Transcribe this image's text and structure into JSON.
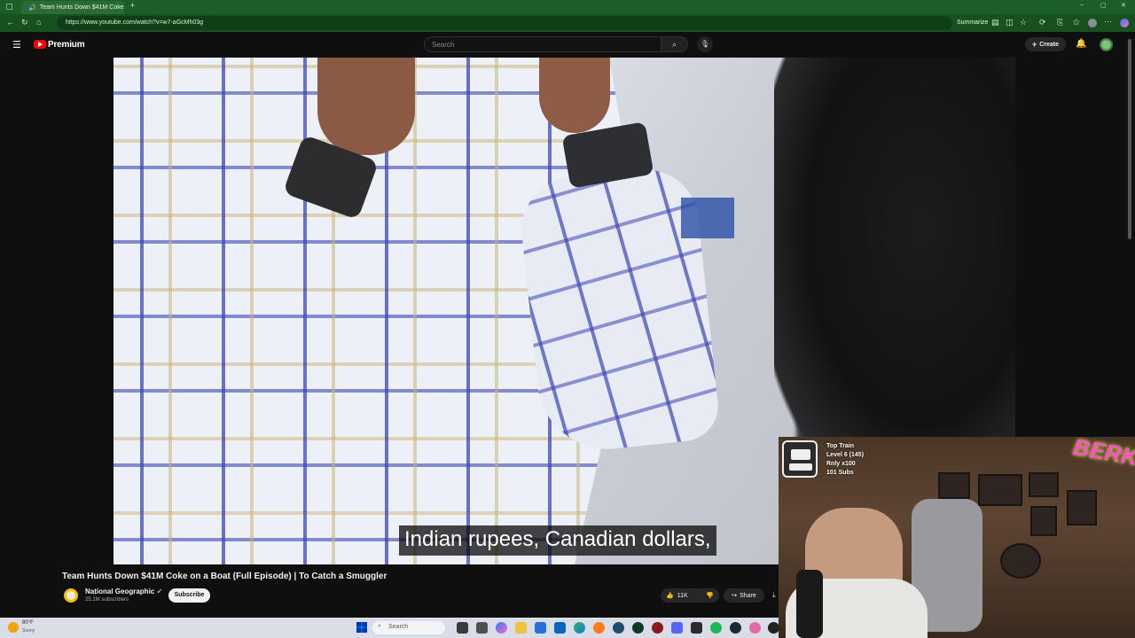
{
  "browser": {
    "tab_title": "Team Hunts Down $41M Coke",
    "url": "https://www.youtube.com/watch?v=w7-aGcMh03g",
    "summarize_label": "Summarize"
  },
  "youtube": {
    "logo_text": "Premium",
    "search_placeholder": "Search",
    "create_label": "Create"
  },
  "video": {
    "caption": "Indian rupees, Canadian dollars,",
    "title": "Team Hunts Down $41M Coke on a Boat (Full Episode) | To Catch a Smuggler",
    "channel_name": "National Geographic",
    "subscribers": "25.1M subscribers",
    "subscribe_label": "Subscribe",
    "likes": "11K",
    "share_label": "Share"
  },
  "webcam": {
    "train_lines": [
      "Top Train",
      "Level 6  (145)",
      "Rnly x100",
      "101 Subs"
    ],
    "logo_text": "BERK"
  },
  "taskbar": {
    "weather_temp": "80°F",
    "weather_condition": "Sunny",
    "search_placeholder": "Search"
  },
  "colors": {
    "tabbar": "#1b5e2a",
    "youtube_red": "#ff0000",
    "background": "#0f0f0f"
  }
}
